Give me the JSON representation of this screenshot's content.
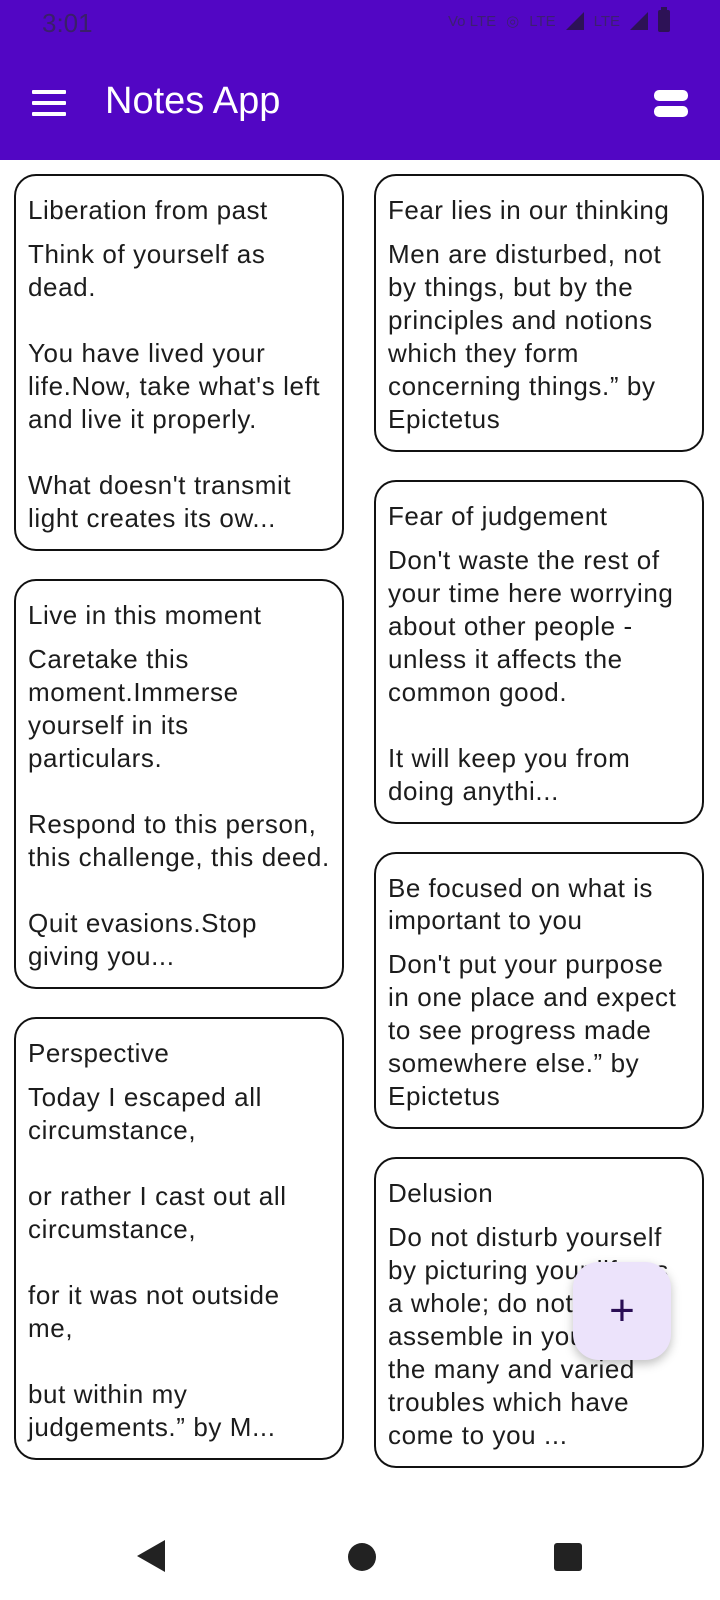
{
  "status_bar": {
    "time": "3:01",
    "indicators": [
      "Vo LTE",
      "LTE",
      "LTE"
    ]
  },
  "app_bar": {
    "title": "Notes App",
    "menu_icon": "hamburger-menu-icon",
    "layout_icon": "view-toggle-icon"
  },
  "notes_left": [
    {
      "title": "Liberation from past",
      "body": "Think of yourself as dead.\n\nYou have lived your life.Now, take what's left and live it properly.\n\nWhat doesn't transmit light creates its ow..."
    },
    {
      "title": "Live in this moment",
      "body": "Caretake this moment.Immerse yourself in its particulars.\n\nRespond to this person, this challenge, this deed.\n\nQuit evasions.Stop giving you..."
    },
    {
      "title": "Perspective",
      "body": "Today I escaped all circumstance,\n\nor rather I cast out all circumstance,\n\n for it was not outside me,\n\n but within my judgements.” by M..."
    }
  ],
  "notes_right": [
    {
      "title": "Fear lies in our thinking",
      "body": "Men are disturbed, not by things, but by the principles and notions which they form concerning things.” by Epictetus"
    },
    {
      "title": "Fear of judgement",
      "body": "Don't waste the rest of your time here worrying about other people - unless it affects the common good.\n\nIt will keep you from doing anythi..."
    },
    {
      "title": "Be focused on what is important to you",
      "body": "Don't put your purpose in one place and expect to see progress made somewhere else.” by Epictetus"
    },
    {
      "title": "Delusion",
      "body": "Do not disturb yourself by picturing your life as a whole; do not assemble in your mind the many and varied troubles which have come to you ..."
    }
  ],
  "fab": {
    "label": "+",
    "icon": "add-icon"
  },
  "nav_bar": {
    "back_icon": "back-icon",
    "home_icon": "home-icon",
    "recents_icon": "recents-icon"
  },
  "colors": {
    "primary": "#5206c4",
    "fab_bg": "#ece3fb",
    "card_border": "#111111"
  }
}
